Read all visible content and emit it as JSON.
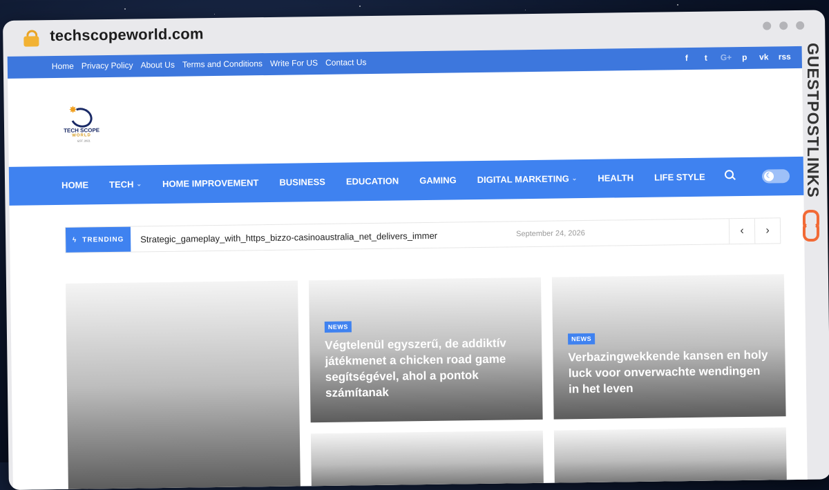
{
  "browser": {
    "url": "techscopeworld.com"
  },
  "topbar": {
    "links": [
      "Home",
      "Privacy Policy",
      "About Us",
      "Terms and Conditions",
      "Write For US",
      "Contact Us"
    ],
    "social": [
      "f",
      "t",
      "G+",
      "p",
      "vk",
      "rss"
    ]
  },
  "logo": {
    "line1": "TECH SCOPE",
    "line2": "WORLD",
    "line3": "EST. 2021"
  },
  "nav": {
    "items": [
      {
        "label": "HOME",
        "dropdown": false
      },
      {
        "label": "TECH",
        "dropdown": true
      },
      {
        "label": "HOME IMPROVEMENT",
        "dropdown": false
      },
      {
        "label": "BUSINESS",
        "dropdown": false
      },
      {
        "label": "EDUCATION",
        "dropdown": false
      },
      {
        "label": "GAMING",
        "dropdown": false
      },
      {
        "label": "DIGITAL MARKETING",
        "dropdown": true
      },
      {
        "label": "HEALTH",
        "dropdown": false
      },
      {
        "label": "LIFE STYLE",
        "dropdown": false
      }
    ],
    "caret": "⌄",
    "dark_mode_glyph": "☾"
  },
  "trending": {
    "label": "TRENDING",
    "icon_glyph": "ϟ",
    "headline": "Strategic_gameplay_with_https_bizzo-casinoaustralia_net_delivers_immersive_casin",
    "date": "September 24, 2026",
    "prev": "‹",
    "next": "›"
  },
  "cards": [
    {
      "badge": "",
      "title": ""
    },
    {
      "badge": "NEWS",
      "title": "Végtelenül egyszerű, de addiktív játékmenet a chicken road game segítségével, ahol a pontok számítanak"
    },
    {
      "badge": "NEWS",
      "title": "Verbazingwekkende kansen en holy luck voor onverwachte wendingen in het leven"
    }
  ],
  "watermark": {
    "text": "GUESTPOSTLINKS"
  },
  "colors": {
    "accent": "#3f82f0",
    "topbar": "#3d77dd",
    "watermark_icon": "#f26a36"
  }
}
